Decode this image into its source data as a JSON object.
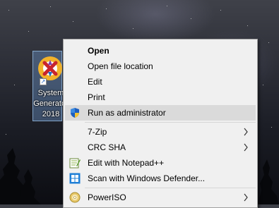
{
  "desktop": {
    "icon_label": "System\nGenerator\n2018"
  },
  "context_menu": {
    "items": [
      {
        "label": "Open",
        "bold": true,
        "icon": "",
        "submenu": false
      },
      {
        "label": "Open file location",
        "icon": "",
        "submenu": false
      },
      {
        "label": "Edit",
        "icon": "",
        "submenu": false
      },
      {
        "label": "Print",
        "icon": "",
        "submenu": false
      },
      {
        "label": "Run as administrator",
        "icon": "uac-shield-icon",
        "submenu": false,
        "highlighted": true
      },
      {
        "label": "7-Zip",
        "icon": "",
        "submenu": true
      },
      {
        "label": "CRC SHA",
        "icon": "",
        "submenu": true
      },
      {
        "label": "Edit with Notepad++",
        "icon": "notepad-plus-plus-icon",
        "submenu": false
      },
      {
        "label": "Scan with Windows Defender...",
        "icon": "windows-defender-icon",
        "submenu": false
      },
      {
        "label": "PowerISO",
        "icon": "poweriso-disc-icon",
        "submenu": true
      }
    ]
  },
  "colors": {
    "menu_background": "#f0f0f0",
    "menu_highlight": "#dadada",
    "selection_blue": "#78aae6"
  }
}
